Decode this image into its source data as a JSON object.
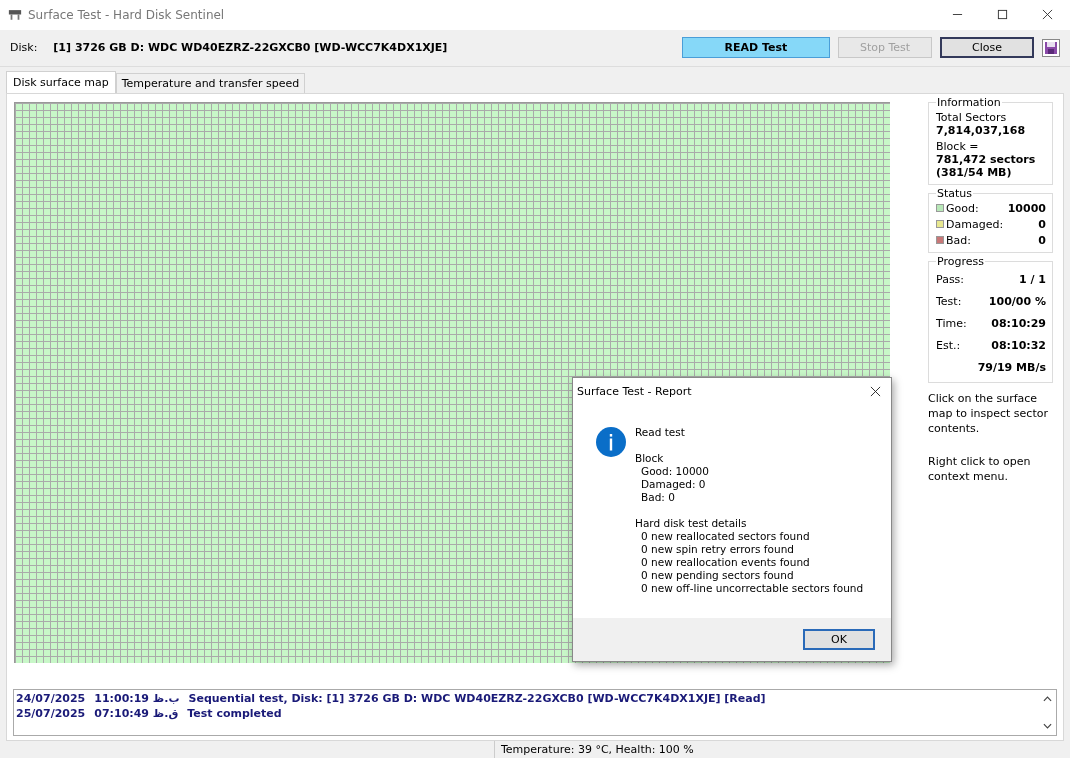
{
  "window": {
    "title": "Surface Test - Hard Disk Sentinel"
  },
  "disk_bar": {
    "label": "Disk:",
    "value": "[1] 3726 GB D: WDC WD40EZRZ-22GXCB0 [WD-WCC7K4DX1XJE]",
    "buttons": [
      {
        "label": "READ Test",
        "kind": "primary",
        "disabled": false
      },
      {
        "label": "Stop Test",
        "kind": "normal",
        "disabled": true
      },
      {
        "label": "Close",
        "kind": "default",
        "disabled": false
      }
    ]
  },
  "tabs": [
    {
      "label": "Disk surface map",
      "selected": true
    },
    {
      "label": "Temperature and transfer speed",
      "selected": false
    }
  ],
  "information": {
    "title": "Information",
    "items": [
      {
        "label": "Total Sectors",
        "values": [
          "7,814,037,168"
        ]
      },
      {
        "label": "Block =",
        "values": [
          "781,472 sectors",
          "(381/54 MB)"
        ]
      }
    ]
  },
  "status": {
    "title": "Status",
    "items": [
      {
        "label": "Good:",
        "value": "10000",
        "color": "#b8e8b8"
      },
      {
        "label": "Damaged:",
        "value": "0",
        "color": "#e8e890"
      },
      {
        "label": "Bad:",
        "value": "0",
        "color": "#c87878"
      }
    ]
  },
  "progress": {
    "title": "Progress",
    "rows": [
      {
        "label": "Pass:",
        "value": "1 / 1"
      },
      {
        "label": "Test:",
        "value": "100/00 %"
      },
      {
        "label": "Time:",
        "value": "08:10:29"
      },
      {
        "label": "Est.:",
        "value": "08:10:32"
      }
    ],
    "speed": "79/19 MB/s"
  },
  "hints": [
    "Click on the surface map to inspect sector contents.",
    "Right click to open context menu."
  ],
  "log": [
    {
      "date": "24/07/2025",
      "time": "11:00:19 ب.ظ",
      "message": "Sequential test, Disk: [1] 3726 GB D: WDC WD40EZRZ-22GXCB0 [WD-WCC7K4DX1XJE] [Read]"
    },
    {
      "date": "25/07/2025",
      "time": "07:10:49 ق.ظ",
      "message": "Test completed"
    }
  ],
  "status_bar": {
    "text": "Temperature: 39  °C,  Health: 100 %"
  },
  "dialog": {
    "title": "Surface Test - Report",
    "heading": "Read test",
    "block_title": "Block",
    "block_lines": [
      "Good: 10000",
      "Damaged: 0",
      "Bad: 0"
    ],
    "details_title": "Hard disk test details",
    "details_lines": [
      "0 new reallocated sectors found",
      "0 new spin retry errors found",
      "0 new reallocation events found",
      "0 new pending sectors found",
      "0 new off-line uncorrectable sectors found"
    ],
    "ok": "OK"
  }
}
